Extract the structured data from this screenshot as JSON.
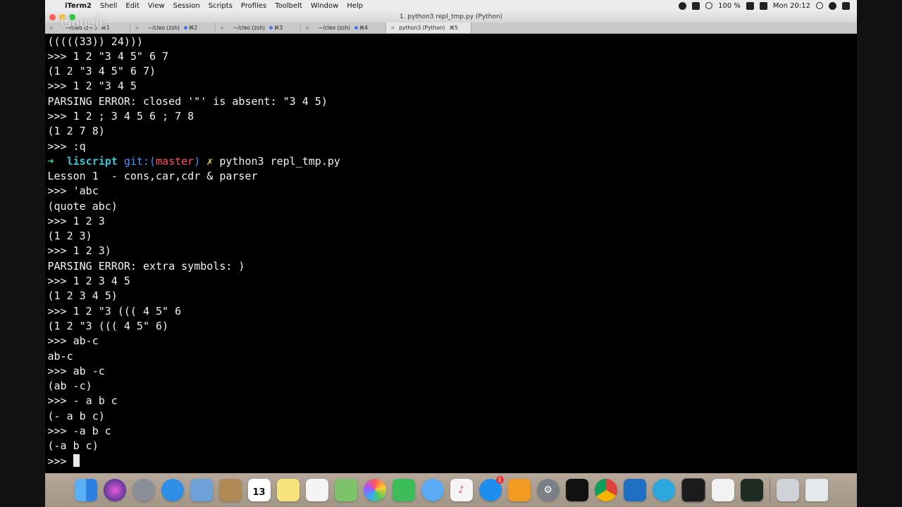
{
  "menubar": {
    "items": [
      "iTerm2",
      "Shell",
      "Edit",
      "View",
      "Session",
      "Scripts",
      "Profiles",
      "Toolbelt",
      "Window",
      "Help"
    ],
    "battery": "100 %",
    "clock": "Mon 20:12"
  },
  "window": {
    "title": "1. python3 repl_tmp.py (Python)"
  },
  "watermark": "Google",
  "tabs": [
    {
      "label": "~/cleo (zsh)",
      "shortcut": "⌘1"
    },
    {
      "label": "~/cleo (zsh)",
      "shortcut": "⌘2"
    },
    {
      "label": "~/cleo (zsh)",
      "shortcut": "⌘3"
    },
    {
      "label": "~/cleo (zsh)",
      "shortcut": "⌘4"
    },
    {
      "label": "python3 (Python)",
      "shortcut": "⌘5"
    }
  ],
  "terminal": {
    "lines": [
      "(((((33)) 24)))",
      ">>> 1 2 \"3 4 5\" 6 7",
      "(1 2 \"3 4 5\" 6 7)",
      ">>> 1 2 \"3 4 5",
      "PARSING ERROR: closed '\"' is absent: \"3 4 5)",
      ">>> 1 2 ; 3 4 5 6 ; 7 8",
      "(1 2 7 8)",
      ">>> :q",
      "",
      "Lesson 1  - cons,car,cdr & parser",
      ">>> 'abc",
      "(quote abc)",
      ">>> 1 2 3",
      "(1 2 3)",
      ">>> 1 2 3)",
      "PARSING ERROR: extra symbols: )",
      ">>> 1 2 3 4 5",
      "(1 2 3 4 5)",
      ">>> 1 2 \"3 ((( 4 5\" 6",
      "(1 2 \"3 ((( 4 5\" 6)",
      ">>> ab-c",
      "ab-c",
      ">>> ab -c",
      "(ab -c)",
      ">>> - a b c",
      "(- a b c)",
      ">>> -a b c",
      "(-a b c)"
    ],
    "shell_prompt": {
      "arrow": "➜",
      "dir": "liscript",
      "git_label": "git:(",
      "branch": "master",
      "git_close": ")",
      "dirty_mark": "✗",
      "command": "python3 repl_tmp.py"
    },
    "current_prompt": ">>> "
  },
  "dock": {
    "calendar_day": "13",
    "app_store_badge": "1",
    "icons": [
      "finder-icon",
      "siri-icon",
      "launchpad-icon",
      "safari-icon",
      "preview-icon",
      "notes-book-icon",
      "calendar-icon",
      "notes-icon",
      "reminders-icon",
      "maps-icon",
      "photos-icon",
      "facetime-icon",
      "messages-icon",
      "itunes-icon",
      "app-store-icon",
      "ibooks-icon",
      "system-preferences-icon",
      "intellij-icon",
      "chrome-icon",
      "vscode-icon",
      "telegram-icon",
      "terminal-icon",
      "textedit-icon",
      "activity-monitor-icon",
      "trash-icon"
    ]
  }
}
